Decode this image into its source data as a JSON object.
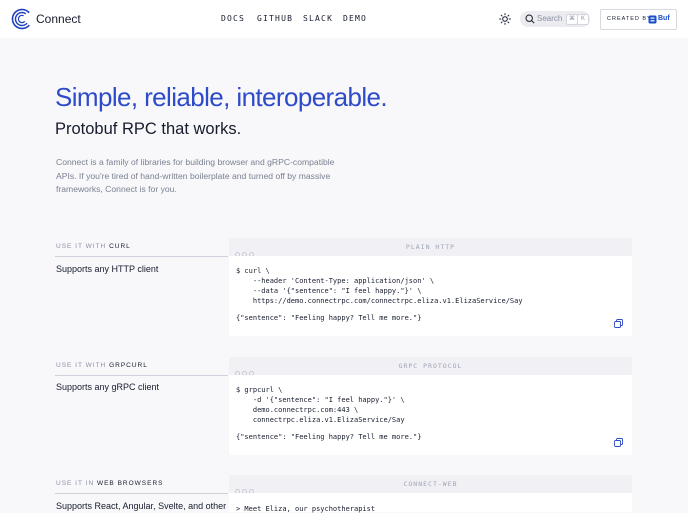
{
  "header": {
    "brand": "Connect",
    "nav": [
      "DOCS",
      "GITHUB",
      "SLACK",
      "DEMO"
    ],
    "search_placeholder": "Search",
    "search_keys": [
      "⌘",
      "K"
    ],
    "created_by": "CREATED BY",
    "buf_label": "Buf"
  },
  "hero": {
    "title": "Simple, reliable, interoperable.",
    "subtitle": "Protobuf RPC that works.",
    "intro": "Connect is a family of libraries for building browser and gRPC-compatible APIs. If you're tired of hand-written boilerplate and turned off by massive frameworks, Connect is for you."
  },
  "sections": [
    {
      "label_prefix": "USE IT WITH",
      "label_name": "CURL",
      "description": "Supports any HTTP client",
      "code_title": "PLAIN HTTP",
      "code": [
        "$ curl \\",
        "    --header 'Content-Type: application/json' \\",
        "    --data '{\"sentence\": \"I feel happy.\"}' \\",
        "    https://demo.connectrpc.com/connectrpc.eliza.v1.ElizaService/Say",
        "",
        "{\"sentence\": \"Feeling happy? Tell me more.\"}"
      ]
    },
    {
      "label_prefix": "USE IT WITH",
      "label_name": "GRPCURL",
      "description": "Supports any gRPC client",
      "code_title": "GRPC PROTOCOL",
      "code": [
        "$ grpcurl \\",
        "    -d '{\"sentence\": \"I feel happy.\"}' \\",
        "    demo.connectrpc.com:443 \\",
        "    connectrpc.eliza.v1.ElizaService/Say",
        "",
        "{\"sentence\": \"Feeling happy? Tell me more.\"}"
      ]
    },
    {
      "label_prefix": "USE IT IN",
      "label_name": "WEB BROWSERS",
      "description": "Supports React, Angular, Svelte, and other",
      "code_title": "CONNECT-WEB",
      "code": [
        "> Meet Eliza, our psychotherapist"
      ]
    }
  ]
}
